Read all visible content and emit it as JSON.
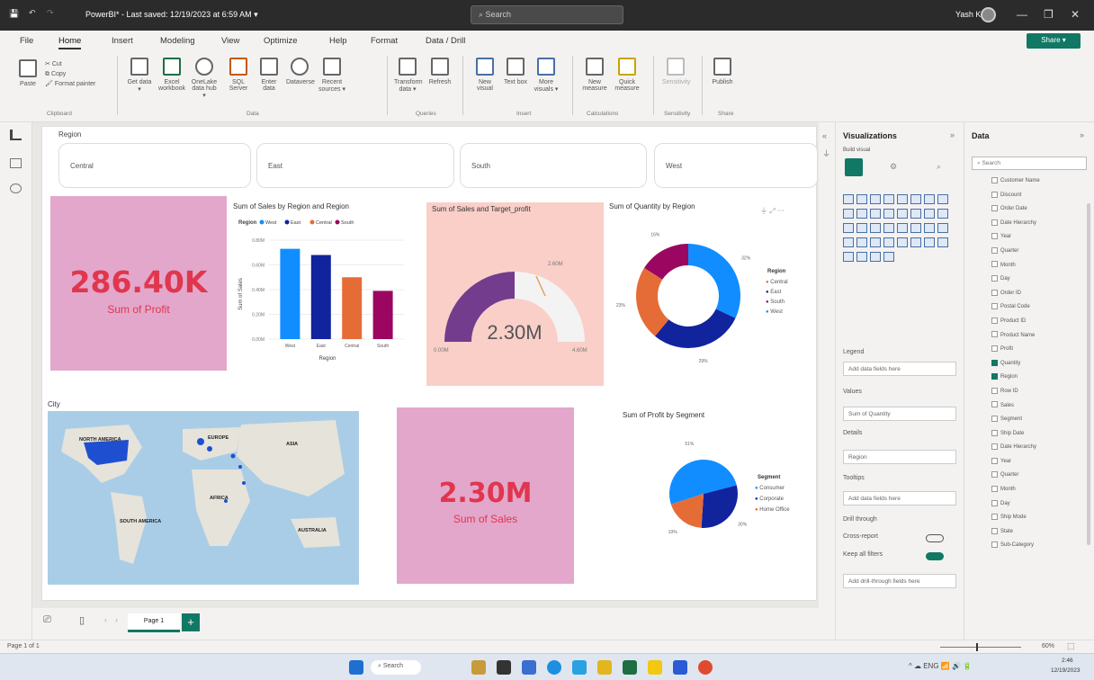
{
  "titlebar": {
    "title": "PowerBI* - Last saved: 12/19/2023 at 6:59 AM ▾",
    "search": "Search",
    "user": "Yash K"
  },
  "menu": [
    "File",
    "Home",
    "Insert",
    "Modeling",
    "View",
    "Optimize",
    "Help",
    "Format",
    "Data / Drill"
  ],
  "share_label": "Share ▾",
  "ribbon": {
    "groups": [
      "Clipboard",
      "Data",
      "Queries",
      "Insert",
      "Calculations",
      "Sensitivity",
      "Share"
    ],
    "buttons": [
      "Paste",
      "Get data ▾",
      "Excel workbook",
      "OneLake data hub ▾",
      "SQL Server",
      "Enter data",
      "Dataverse",
      "Recent sources ▾",
      "Transform data ▾",
      "Refresh",
      "New visual",
      "Text box",
      "More visuals ▾",
      "New measure",
      "Quick measure",
      "Sensitivity",
      "Publish"
    ],
    "clip": [
      "Cut",
      "Copy",
      "Format painter"
    ]
  },
  "slicer": {
    "title": "Region",
    "items": [
      "Central",
      "East",
      "South",
      "West"
    ]
  },
  "card1": {
    "value": "286.40K",
    "label": "Sum of Profit"
  },
  "card2": {
    "value": "2.30M",
    "label": "Sum of Sales"
  },
  "bar": {
    "title": "Sum of Sales by Region and Region",
    "legend_title": "Region",
    "xlabel": "Region",
    "ylabel": "Sum of Sales"
  },
  "gauge": {
    "title": "Sum of Sales and Target_profit",
    "value": "2.30M",
    "target": "2.60M",
    "min": "0.00M",
    "max": "4.60M"
  },
  "donut": {
    "title": "Sum of Quantity by Region",
    "legend_title": "Region",
    "labels": [
      "Central",
      "East",
      "South",
      "West"
    ]
  },
  "map": {
    "title": "City",
    "labels": [
      "NORTH AMERICA",
      "EUROPE",
      "ASIA",
      "AFRICA",
      "SOUTH AMERICA",
      "AUSTRALIA"
    ]
  },
  "pie": {
    "title": "Sum of Profit by Segment",
    "legend_title": "Segment",
    "labels": [
      "Consumer",
      "Corporate",
      "Home Office"
    ]
  },
  "chart_data": [
    {
      "type": "bar",
      "title": "Sum of Sales by Region and Region",
      "categories": [
        "West",
        "East",
        "Central",
        "South"
      ],
      "values": [
        0.73,
        0.68,
        0.5,
        0.39
      ],
      "ylabel": "Sum of Sales",
      "xlabel": "Region",
      "ylim": [
        0,
        0.8
      ],
      "colors": [
        "#118dff",
        "#12239e",
        "#e66c37",
        "#9b0760"
      ]
    },
    {
      "type": "pie",
      "title": "Sum of Quantity by Region",
      "categories": [
        "West",
        "East",
        "Central",
        "South"
      ],
      "values": [
        32,
        29,
        23,
        16
      ],
      "colors": [
        "#118dff",
        "#12239e",
        "#e66c37",
        "#9b0760"
      ]
    },
    {
      "type": "pie",
      "title": "Sum of Profit by Segment",
      "categories": [
        "Consumer",
        "Corporate",
        "Home Office"
      ],
      "values": [
        51,
        30,
        19
      ],
      "colors": [
        "#118dff",
        "#12239e",
        "#e66c37"
      ]
    }
  ],
  "viz": {
    "title": "Visualizations",
    "build": "Build visual",
    "legend_label": "Legend",
    "legend_well": "Add data fields here",
    "values_label": "Values",
    "values_well": "Sum of Quantity",
    "details_label": "Details",
    "details_well": "Region",
    "tooltips_label": "Tooltips",
    "tooltips_well": "Add data fields here",
    "drill_label": "Drill through",
    "cross_report": "Cross-report",
    "keep_filters": "Keep all filters",
    "drill_well": "Add drill-through fields here"
  },
  "data": {
    "title": "Data",
    "search": "Search",
    "fields": [
      "Customer Name",
      "Discount",
      "Order Date",
      "Date Hierarchy",
      "Year",
      "Quarter",
      "Month",
      "Day",
      "Order ID",
      "Postal Code",
      "Product ID",
      "Product Name",
      "Profit",
      "Quantity",
      "Region",
      "Row ID",
      "Sales",
      "Segment",
      "Ship Date",
      "Date Hierarchy",
      "Year",
      "Quarter",
      "Month",
      "Day",
      "Ship Mode",
      "State",
      "Sub-Category"
    ]
  },
  "pages": {
    "tab": "Page 1",
    "add": "+"
  },
  "status": {
    "page": "Page 1 of 1",
    "zoom": "60%"
  },
  "taskbar": {
    "search": "Search",
    "time": "2:46",
    "date": "12/19/2023"
  }
}
